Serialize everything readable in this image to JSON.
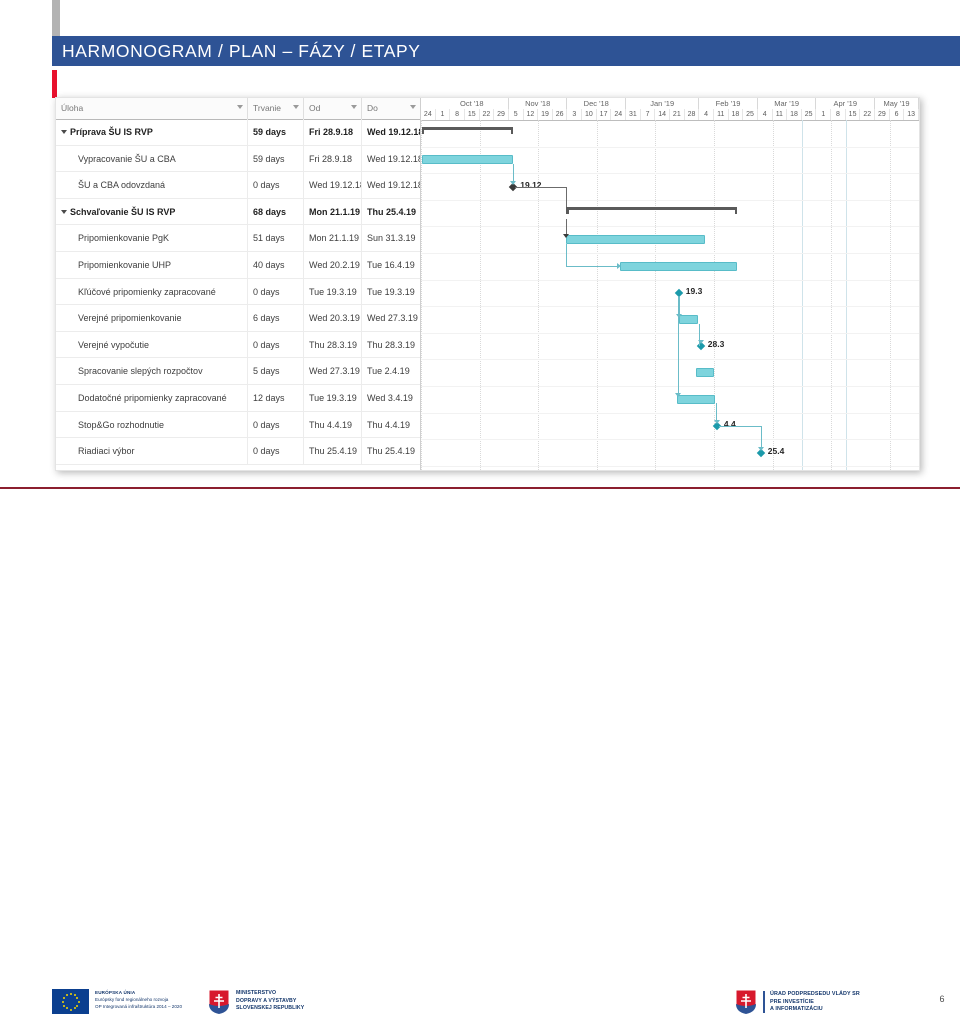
{
  "slide": {
    "title": "HARMONOGRAM / PLAN – FÁZY / ETAPY",
    "page_number": "6",
    "accent_blue": "#2e5395",
    "accent_red": "#e8112d",
    "bar_teal": "#6ecbd5"
  },
  "gantt": {
    "columns": [
      "Úloha",
      "Trvanie",
      "Od",
      "Do"
    ],
    "rows": [
      {
        "name": "Príprava ŠU IS RVP",
        "duration": "59 days",
        "from": "Fri 28.9.18",
        "to": "Wed 19.12.18",
        "type": "summary"
      },
      {
        "name": "Vypracovanie ŠU a CBA",
        "duration": "59 days",
        "from": "Fri 28.9.18",
        "to": "Wed 19.12.18",
        "type": "task"
      },
      {
        "name": "ŠU a CBA odovzdaná",
        "duration": "0 days",
        "from": "Wed 19.12.18",
        "to": "Wed 19.12.18",
        "type": "milestone"
      },
      {
        "name": "Schvaľovanie ŠU IS RVP",
        "duration": "68 days",
        "from": "Mon 21.1.19",
        "to": "Thu 25.4.19",
        "type": "summary"
      },
      {
        "name": "Pripomienkovanie PgK",
        "duration": "51 days",
        "from": "Mon 21.1.19",
        "to": "Sun 31.3.19",
        "type": "task"
      },
      {
        "name": "Pripomienkovanie UHP",
        "duration": "40 days",
        "from": "Wed 20.2.19",
        "to": "Tue 16.4.19",
        "type": "task"
      },
      {
        "name": "Kľúčové pripomienky zapracované",
        "duration": "0 days",
        "from": "Tue 19.3.19",
        "to": "Tue 19.3.19",
        "type": "milestone"
      },
      {
        "name": "Verejné pripomienkovanie",
        "duration": "6 days",
        "from": "Wed 20.3.19",
        "to": "Wed 27.3.19",
        "type": "task"
      },
      {
        "name": "Verejné vypočutie",
        "duration": "0 days",
        "from": "Thu 28.3.19",
        "to": "Thu 28.3.19",
        "type": "milestone"
      },
      {
        "name": "Spracovanie slepých rozpočtov",
        "duration": "5 days",
        "from": "Wed 27.3.19",
        "to": "Tue 2.4.19",
        "type": "task"
      },
      {
        "name": "Dodatočné pripomienky zapracované",
        "duration": "12 days",
        "from": "Tue 19.3.19",
        "to": "Wed 3.4.19",
        "type": "task"
      },
      {
        "name": "Stop&Go rozhodnutie",
        "duration": "0 days",
        "from": "Thu 4.4.19",
        "to": "Thu 4.4.19",
        "type": "milestone"
      },
      {
        "name": "Riadiaci výbor",
        "duration": "0 days",
        "from": "Thu 25.4.19",
        "to": "Thu 25.4.19",
        "type": "milestone"
      }
    ],
    "timeline": {
      "months": [
        "Oct '18",
        "Nov '18",
        "Dec '18",
        "Jan '19",
        "Feb '19",
        "Mar '19",
        "Apr '19",
        "May '19"
      ],
      "days": [
        "24",
        "1",
        "8",
        "15",
        "22",
        "29",
        "5",
        "12",
        "19",
        "26",
        "3",
        "10",
        "17",
        "24",
        "31",
        "7",
        "14",
        "21",
        "28",
        "4",
        "11",
        "18",
        "25",
        "4",
        "11",
        "18",
        "25",
        "1",
        "8",
        "15",
        "22",
        "29",
        "6",
        "13"
      ]
    },
    "milestone_labels": [
      "19.12",
      "19.3",
      "28.3",
      "4.4",
      "25.4"
    ]
  },
  "footer": {
    "eu": {
      "line1": "EURÓPSKA ÚNIA",
      "line2": "Európsky fond regionálneho rozvoja",
      "line3": "OP Integrovaná infraštruktúra 2014 – 2020"
    },
    "ministry": {
      "line1": "MINISTERSTVO",
      "line2": "DOPRAVY A VÝSTAVBY",
      "line3": "SLOVENSKEJ REPUBLIKY"
    },
    "vicepm": {
      "line1": "ÚRAD PODPREDSEDU VLÁDY SR",
      "line2": "PRE INVESTÍCIE",
      "line3": "A INFORMATIZÁCIU"
    }
  }
}
